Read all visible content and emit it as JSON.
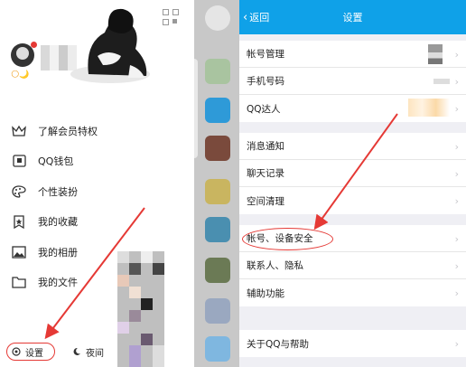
{
  "drawer": {
    "menu": [
      {
        "label": "了解会员特权",
        "icon": "crown-icon"
      },
      {
        "label": "QQ钱包",
        "icon": "wallet-icon"
      },
      {
        "label": "个性装扮",
        "icon": "palette-icon"
      },
      {
        "label": "我的收藏",
        "icon": "bookmark-star-icon"
      },
      {
        "label": "我的相册",
        "icon": "photo-icon"
      },
      {
        "label": "我的文件",
        "icon": "folder-icon"
      }
    ],
    "settings_label": "设置",
    "night_label": "夜间",
    "badges": "🌕🌙"
  },
  "settings": {
    "back_label": "返回",
    "title": "设置",
    "group1": [
      "帐号管理",
      "手机号码",
      "QQ达人"
    ],
    "group2": [
      "消息通知",
      "聊天记录",
      "空间清理"
    ],
    "group3": [
      "帐号、设备安全",
      "联系人、隐私",
      "辅助功能"
    ],
    "group4": [
      "关于QQ与帮助"
    ]
  },
  "colors": {
    "nav_bar": "#0fa1e8",
    "annotation": "#e53935"
  }
}
